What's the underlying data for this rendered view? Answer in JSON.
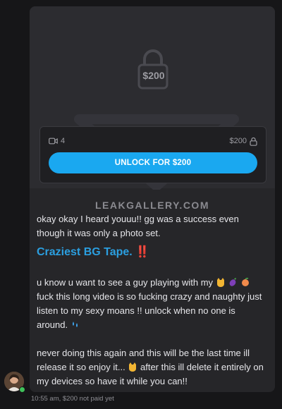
{
  "media": {
    "price_overlay": "$200",
    "video_count": "4",
    "price": "$200",
    "unlock_label": "UNLOCK FOR $200"
  },
  "watermark": "LEAKGALLERY.COM",
  "message": {
    "line1": "okay okay I heard youuu!! gg was a success even though it was only a photo set.",
    "headline": "Craziest BG Tape.",
    "headline_mark": "‼️",
    "para2a": "u know u want to see a guy playing with my",
    "para2b": "fuck this long video is so fucking crazy and naughty just listen to my sexy moans !! unlock when no one is around.",
    "para3a": "never doing this again and this will be the last time ill release it so enjoy it...",
    "para3b": "after this ill delete it entirely on my devices so have it while you can!!"
  },
  "footer": {
    "time": "10:55 am,",
    "status": "$200 not paid yet"
  },
  "colors": {
    "accent": "#1aa8f0",
    "headline": "#2b9fe0",
    "online": "#3fc25a"
  }
}
